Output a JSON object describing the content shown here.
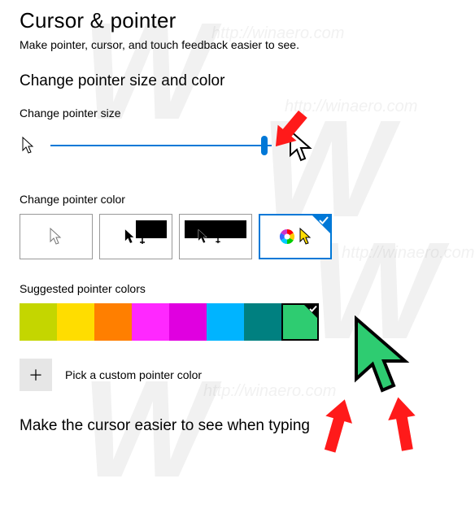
{
  "page": {
    "title": "Cursor & pointer",
    "subtitle": "Make pointer, cursor, and touch feedback easier to see."
  },
  "section_size_color": {
    "heading": "Change pointer size and color",
    "size_label": "Change pointer size",
    "slider_value_percent": 98,
    "color_label": "Change pointer color",
    "color_options": [
      {
        "name": "white-cursor",
        "selected": false
      },
      {
        "name": "black-cursor",
        "selected": false
      },
      {
        "name": "inverted-cursor",
        "selected": false
      },
      {
        "name": "custom-color-cursor",
        "selected": true
      }
    ],
    "suggested_label": "Suggested pointer colors",
    "swatches": [
      {
        "color": "#C4D600",
        "selected": false
      },
      {
        "color": "#FFDD00",
        "selected": false
      },
      {
        "color": "#FF7F00",
        "selected": false
      },
      {
        "color": "#FF28FF",
        "selected": false
      },
      {
        "color": "#E000E0",
        "selected": false
      },
      {
        "color": "#00B4FF",
        "selected": false
      },
      {
        "color": "#008080",
        "selected": false
      },
      {
        "color": "#2ECC71",
        "selected": true
      }
    ],
    "custom_label": "Pick a custom pointer color",
    "plus_glyph": "＋"
  },
  "section_cursor": {
    "heading": "Make the cursor easier to see when typing"
  },
  "watermark": {
    "glyph": "W",
    "url": "http://winaero.com"
  }
}
